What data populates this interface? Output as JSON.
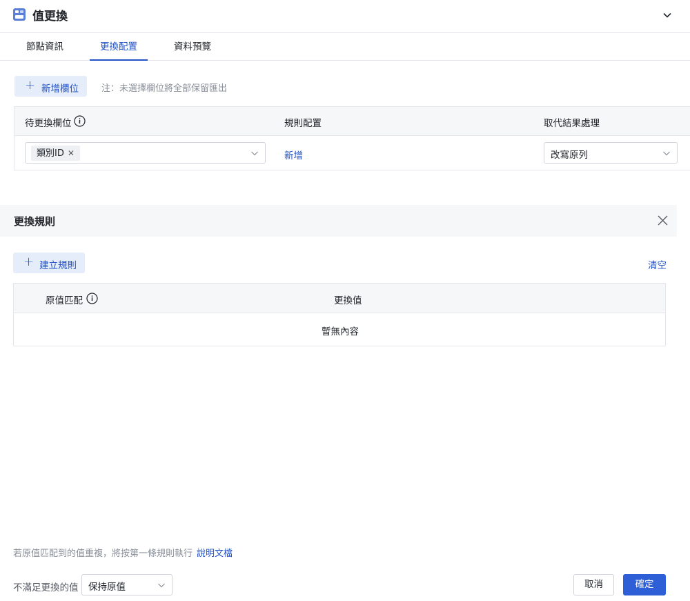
{
  "header": {
    "title": "值更換",
    "icon": "data-transform-icon"
  },
  "tabs": [
    {
      "label": "節點資訊",
      "active": false
    },
    {
      "label": "更換配置",
      "active": true
    },
    {
      "label": "資料預覽",
      "active": false
    }
  ],
  "config": {
    "add_field_label": "新增欄位",
    "note": "注：未選擇欄位將全部保留匯出",
    "table": {
      "columns": [
        "待更換欄位",
        "規則配置",
        "取代結果處理"
      ],
      "row": {
        "field_tag": "類別ID",
        "rule_link": "新增",
        "result_value": "改寫原列"
      }
    }
  },
  "rules_panel": {
    "title": "更換規則",
    "create_rule_label": "建立規則",
    "clear_label": "清空",
    "table": {
      "columns": [
        "原值匹配",
        "更換值"
      ],
      "empty_text": "暫無內容"
    }
  },
  "footer": {
    "note": "若原值匹配到的值重複，將按第一條規則執行",
    "doc_link": "說明文檔",
    "fallback_label": "不滿足更換的值",
    "fallback_value": "保持原值",
    "cancel_label": "取消",
    "ok_label": "確定"
  },
  "colors": {
    "accent": "#2151c5",
    "primary_button": "#2f5fd7",
    "light_button": "#e5edfb",
    "header_bg": "#f6f7f9"
  }
}
